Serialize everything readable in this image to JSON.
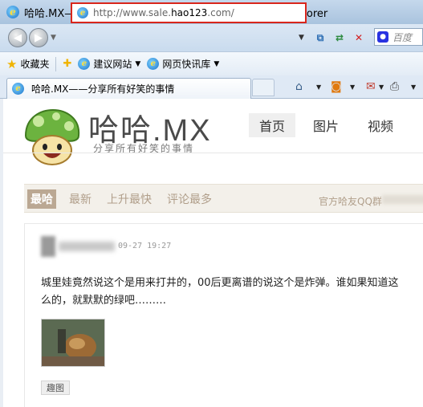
{
  "window": {
    "title": "哈哈.MX——分享所有好笑的事情 - Windows Internet Explorer"
  },
  "address_bar": {
    "url_prefix": "http://www.sale.",
    "url_host": "hao123",
    "url_suffix": ".com/"
  },
  "search": {
    "placeholder": "百度"
  },
  "favorites_bar": {
    "favorites_label": "收藏夹",
    "items": [
      {
        "label": "建议网站"
      },
      {
        "label": "网页快讯库"
      }
    ]
  },
  "tabs": [
    {
      "title": "哈哈.MX——分享所有好笑的事情"
    }
  ],
  "site": {
    "logo_text": "哈哈.MX",
    "slogan": "分享所有好笑的事情",
    "nav": [
      {
        "label": "首页"
      },
      {
        "label": "图片"
      },
      {
        "label": "视频"
      }
    ],
    "subnav": [
      {
        "label": "最哈"
      },
      {
        "label": "最新"
      },
      {
        "label": "上升最快"
      },
      {
        "label": "评论最多"
      }
    ],
    "qq_group_label": "官方哈友QQ群"
  },
  "post": {
    "time": "09-27 19:27",
    "text_line1": "城里娃竟然说这个是用来打井的，00后更离谱的说这个是炸弹。谁如果知道这",
    "text_line2": "么的，就默默的绿吧………",
    "tag": "趣图"
  },
  "colors": {
    "address_highlight": "#d9261c",
    "subnav_active": "#bba893",
    "subnav_text": "#b09e8a"
  }
}
